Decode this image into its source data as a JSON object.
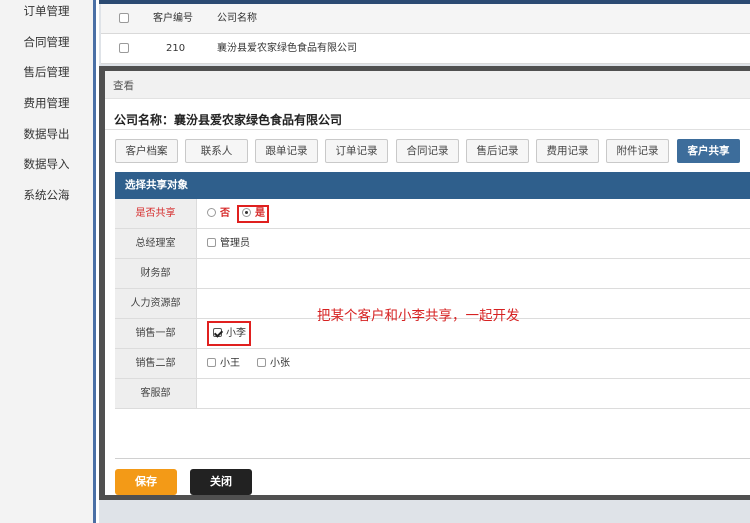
{
  "sidebar": {
    "items": [
      {
        "label": "订单管理"
      },
      {
        "label": "合同管理"
      },
      {
        "label": "售后管理"
      },
      {
        "label": "费用管理"
      },
      {
        "label": "数据导出"
      },
      {
        "label": "数据导入"
      },
      {
        "label": "系统公海"
      }
    ]
  },
  "table": {
    "headers": {
      "id": "客户编号",
      "name": "公司名称"
    },
    "rows": [
      {
        "id": "210",
        "name": "襄汾县爱农家绿色食品有限公司"
      }
    ]
  },
  "modal": {
    "title": "查看",
    "company_label": "公司名称：襄汾县爱农家绿色食品有限公司",
    "tabs": [
      {
        "label": "客户档案"
      },
      {
        "label": "联系人"
      },
      {
        "label": "跟单记录"
      },
      {
        "label": "订单记录"
      },
      {
        "label": "合同记录"
      },
      {
        "label": "售后记录"
      },
      {
        "label": "费用记录"
      },
      {
        "label": "附件记录"
      },
      {
        "label": "客户共享"
      }
    ],
    "active_tab": "客户共享",
    "share_header": "选择共享对象",
    "share_question": {
      "label": "是否共享",
      "options": [
        {
          "label": "否",
          "selected": false
        },
        {
          "label": "是",
          "selected": true
        }
      ]
    },
    "departments": [
      {
        "label": "总经理室",
        "members": [
          {
            "label": "管理员",
            "checked": false
          }
        ]
      },
      {
        "label": "财务部",
        "members": []
      },
      {
        "label": "人力资源部",
        "members": []
      },
      {
        "label": "销售一部",
        "members": [
          {
            "label": "小李",
            "checked": true
          }
        ]
      },
      {
        "label": "销售二部",
        "members": [
          {
            "label": "小王",
            "checked": false
          },
          {
            "label": "小张",
            "checked": false
          }
        ]
      },
      {
        "label": "客服部",
        "members": []
      }
    ],
    "annotation": "把某个客户和小李共享，一起开发",
    "buttons": {
      "save": "保存",
      "close": "关闭"
    }
  },
  "colors": {
    "accent_blue": "#2f5f8c",
    "active_tab": "#3d6d9b",
    "save_button": "#f39a17",
    "close_button": "#222222",
    "highlight_red": "#e0201f"
  }
}
